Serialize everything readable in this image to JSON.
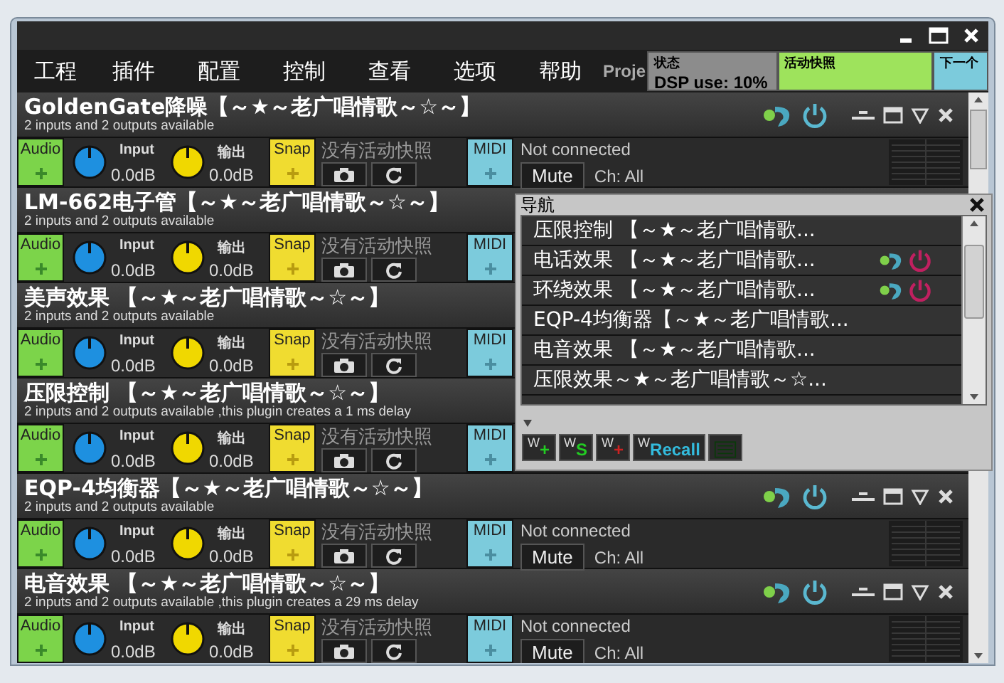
{
  "menu": [
    "工程",
    "插件",
    "配置",
    "控制",
    "查看",
    "选项",
    "帮助"
  ],
  "menu_overflow": "Proje",
  "status_panels": [
    {
      "kind": "status",
      "label": "状态",
      "value": "DSP use: 10%"
    },
    {
      "kind": "snapshot",
      "label": "活动快照"
    },
    {
      "kind": "next",
      "label": "下一个"
    }
  ],
  "plugins": [
    {
      "title": "GoldenGate降噪【～★～老广唱情歌～☆～】",
      "subtitle": "2 inputs and 2 outputs available",
      "audio": "Audio",
      "input_label": "Input",
      "input_value": "0.0dB",
      "output_label": "输出",
      "output_value": "0.0dB",
      "snap": "Snap",
      "snapshot": "没有活动快照",
      "midi_label": "MIDI",
      "midi": {
        "status": "Not connected",
        "mute": "Mute",
        "channel": "Ch: All"
      }
    },
    {
      "title": "LM-662电子管【～★～老广唱情歌～☆～】",
      "subtitle": "2 inputs and 2 outputs available",
      "audio": "Audio",
      "input_label": "Input",
      "input_value": "0.0dB",
      "output_label": "输出",
      "output_value": "0.0dB",
      "snap": "Snap",
      "snapshot": "没有活动快照",
      "midi_label": "MIDI"
    },
    {
      "title": "美声效果 【～★～老广唱情歌～☆～】",
      "subtitle": "2 inputs and 2 outputs available",
      "audio": "Audio",
      "input_label": "Input",
      "input_value": "0.0dB",
      "output_label": "输出",
      "output_value": "0.0dB",
      "snap": "Snap",
      "snapshot": "没有活动快照",
      "midi_label": "MIDI"
    },
    {
      "title": "压限控制 【～★～老广唱情歌～☆～】",
      "subtitle": "2 inputs and 2 outputs available ,this plugin creates a 1 ms delay",
      "audio": "Audio",
      "input_label": "Input",
      "input_value": "0.0dB",
      "output_label": "输出",
      "output_value": "0.0dB",
      "snap": "Snap",
      "snapshot": "没有活动快照",
      "midi_label": "MIDI"
    },
    {
      "title": "EQP-4均衡器【～★～老广唱情歌～☆～】",
      "subtitle": "2 inputs and 2 outputs available",
      "audio": "Audio",
      "input_label": "Input",
      "input_value": "0.0dB",
      "output_label": "输出",
      "output_value": "0.0dB",
      "snap": "Snap",
      "snapshot": "没有活动快照",
      "midi_label": "MIDI",
      "midi": {
        "status": "Not connected",
        "mute": "Mute",
        "channel": "Ch: All"
      }
    },
    {
      "title": "电音效果 【～★～老广唱情歌～☆～】",
      "subtitle": "2 inputs and 2 outputs available ,this plugin creates a 29 ms delay",
      "audio": "Audio",
      "input_label": "Input",
      "input_value": "0.0dB",
      "output_label": "输出",
      "output_value": "0.0dB",
      "snap": "Snap",
      "snapshot": "没有活动快照",
      "midi_label": "MIDI",
      "midi": {
        "status": "Not connected",
        "mute": "Mute",
        "channel": "Ch: All"
      }
    }
  ],
  "navigator": {
    "title": "导航",
    "items": [
      {
        "label": "压限控制 【～★～老广唱情歌...",
        "controls": false
      },
      {
        "label": "电话效果 【～★～老广唱情歌...",
        "controls": true
      },
      {
        "label": "环绕效果 【～★～老广唱情歌...",
        "controls": true
      },
      {
        "label": "EQP-4均衡器【～★～老广唱情歌...",
        "controls": false
      },
      {
        "label": "电音效果 【～★～老广唱情歌...",
        "controls": false
      },
      {
        "label": "压限效果～★～老广唱情歌～☆...",
        "controls": false
      }
    ],
    "tools": [
      {
        "mark": "W",
        "label": "+",
        "color": "#22cc22"
      },
      {
        "mark": "W",
        "label": "S",
        "color": "#22cc22"
      },
      {
        "mark": "W",
        "label": "+",
        "color": "#cc2222"
      },
      {
        "mark": "W",
        "label": "Recall",
        "color": "#33bbdd"
      }
    ]
  }
}
